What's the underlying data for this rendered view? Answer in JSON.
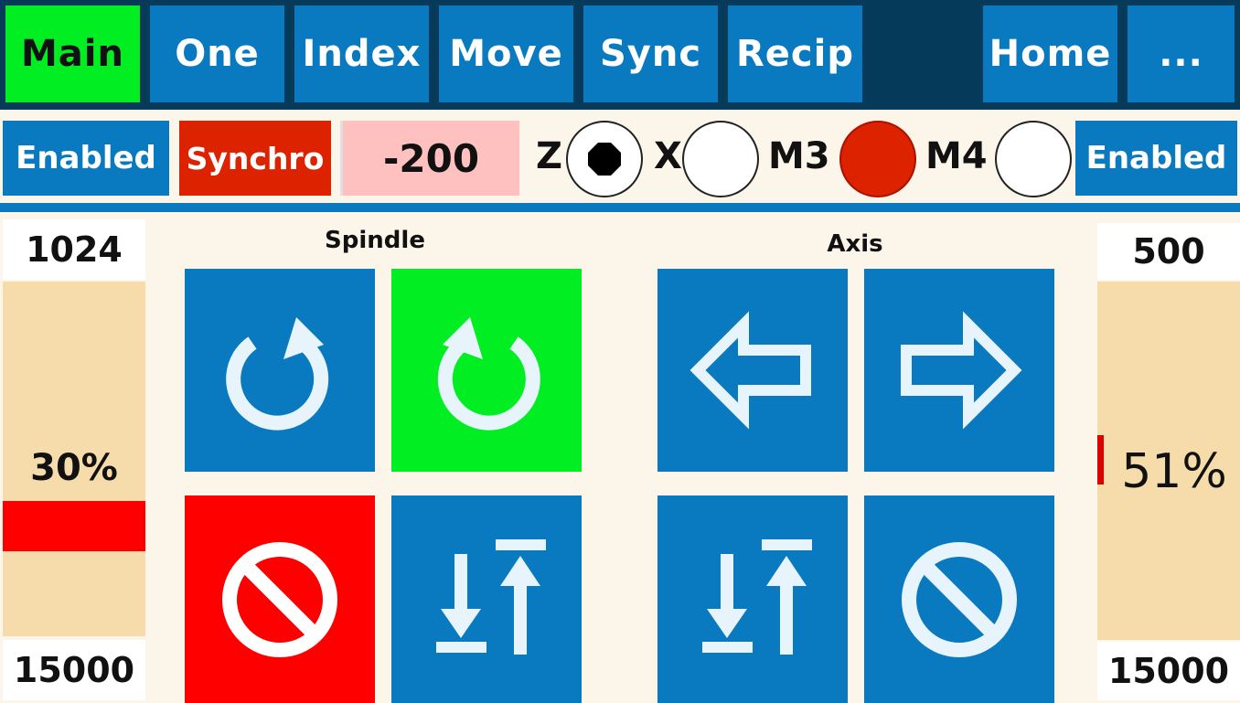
{
  "tabs": [
    {
      "label": "Main"
    },
    {
      "label": "One"
    },
    {
      "label": "Index"
    },
    {
      "label": "Move"
    },
    {
      "label": "Sync"
    },
    {
      "label": "Recip"
    },
    {
      "label": ""
    },
    {
      "label": "Home"
    },
    {
      "label": "..."
    }
  ],
  "controls": {
    "left_status": "Enabled",
    "sync_button": "Synchro",
    "value_field": "-200",
    "right_status": "Enabled",
    "radios": [
      {
        "label": "Z",
        "state": "dot"
      },
      {
        "label": "X",
        "state": "off"
      },
      {
        "label": "M3",
        "state": "on-red"
      },
      {
        "label": "M4",
        "state": "off"
      }
    ]
  },
  "spindle": {
    "title": "Spindle",
    "top_value": "1024",
    "percent": "30%",
    "bottom_value": "15000",
    "fill_fraction": 0.3,
    "fill_color": "#ff0000"
  },
  "axis": {
    "title": "Axis",
    "top_value": "500",
    "percent": "51%",
    "bottom_value": "15000",
    "fill_fraction": 0.51,
    "fill_color": "#dd0000"
  },
  "colors": {
    "blue": "#0a7ac0",
    "green": "#00ee22",
    "red": "#ff0000",
    "panel": "#fbf5ea",
    "gauge": "#f6dcaa"
  },
  "buttons": [
    {
      "name": "spindle-ccw-button",
      "icon": "rotate-ccw-icon"
    },
    {
      "name": "spindle-cw-button",
      "icon": "rotate-cw-icon"
    },
    {
      "name": "spindle-stop-button",
      "icon": "stop-icon"
    },
    {
      "name": "spindle-mode-button",
      "icon": "sort-arrows-icon"
    },
    {
      "name": "axis-left-button",
      "icon": "arrow-left-icon"
    },
    {
      "name": "axis-right-button",
      "icon": "arrow-right-icon"
    },
    {
      "name": "axis-mode-button",
      "icon": "sort-arrows-icon"
    },
    {
      "name": "axis-stop-button",
      "icon": "stop-icon"
    }
  ]
}
